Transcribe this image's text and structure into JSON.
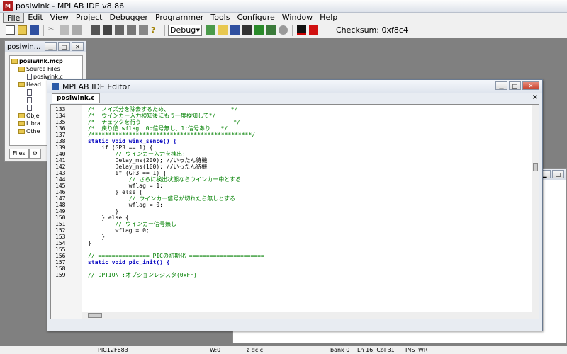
{
  "app": {
    "title": "posiwink - MPLAB IDE v8.86",
    "icon": "mplab-app-icon"
  },
  "menu": [
    "File",
    "Edit",
    "View",
    "Project",
    "Debugger",
    "Programmer",
    "Tools",
    "Configure",
    "Window",
    "Help"
  ],
  "toolbar": {
    "build_config": "Debug",
    "checksum": "Checksum: 0xf8c4"
  },
  "project_window": {
    "title": "posiwin...",
    "tree": [
      {
        "label": "posiwink.mcp",
        "type": "project"
      },
      {
        "label": "Source Files",
        "type": "folder"
      },
      {
        "label": "posiwink.c",
        "type": "file"
      },
      {
        "label": "Head",
        "type": "folder"
      },
      {
        "label": "Obje",
        "type": "folder"
      },
      {
        "label": "Libra",
        "type": "folder"
      },
      {
        "label": "Othe",
        "type": "folder"
      }
    ],
    "tab": "Files"
  },
  "editor": {
    "title": "MPLAB IDE Editor",
    "tab": "posiwink.c",
    "lines": [
      {
        "n": "133",
        "text": "/*  ノイズ分を除去するため、                  */"
      },
      {
        "n": "134",
        "text": "/*  ウインカー入力検知後にもう一度検知して*/"
      },
      {
        "n": "135",
        "text": "/*  チェックを行う                           */"
      },
      {
        "n": "136",
        "text": "/*  戻り値 wflag  0:信号無し、1:信号あり   */"
      },
      {
        "n": "137",
        "text": "/***********************************************/"
      },
      {
        "n": "138",
        "text": "static void wink_sence() {"
      },
      {
        "n": "139",
        "text": "    if (GP3 == 1) {"
      },
      {
        "n": "140",
        "text": "        // ウインカー入力を検出;"
      },
      {
        "n": "141",
        "text": "        Delay_ms(200); //いったん待機"
      },
      {
        "n": "142",
        "text": "        Delay_ms(100); //いったん待機"
      },
      {
        "n": "143",
        "text": "        if (GP3 == 1) {"
      },
      {
        "n": "144",
        "text": "            // さらに検出状態ならウインカー中とする"
      },
      {
        "n": "145",
        "text": "            wflag = 1;"
      },
      {
        "n": "146",
        "text": "        } else {"
      },
      {
        "n": "147",
        "text": "            // ウインカー信号が切れたら無しとする"
      },
      {
        "n": "148",
        "text": "            wflag = 0;"
      },
      {
        "n": "149",
        "text": "        }"
      },
      {
        "n": "150",
        "text": "    } else {"
      },
      {
        "n": "151",
        "text": "        // ウインカー信号無し"
      },
      {
        "n": "152",
        "text": "        wflag = 0;"
      },
      {
        "n": "153",
        "text": "    }"
      },
      {
        "n": "154",
        "text": "}"
      },
      {
        "n": "155",
        "text": ""
      },
      {
        "n": "156",
        "text": "// =============== PICの初期化 ======================"
      },
      {
        "n": "157",
        "text": "static void pic_init() {"
      },
      {
        "n": "158",
        "text": ""
      },
      {
        "n": "159",
        "text": "// OPTION :オプションレジスタ(0xFF)"
      }
    ]
  },
  "status": {
    "device": "PIC12F683",
    "w": "W:0",
    "flags": "z dc c",
    "bank": "bank 0",
    "position": "Ln 16, Col 31",
    "ins": "INS",
    "wr": "WR"
  }
}
